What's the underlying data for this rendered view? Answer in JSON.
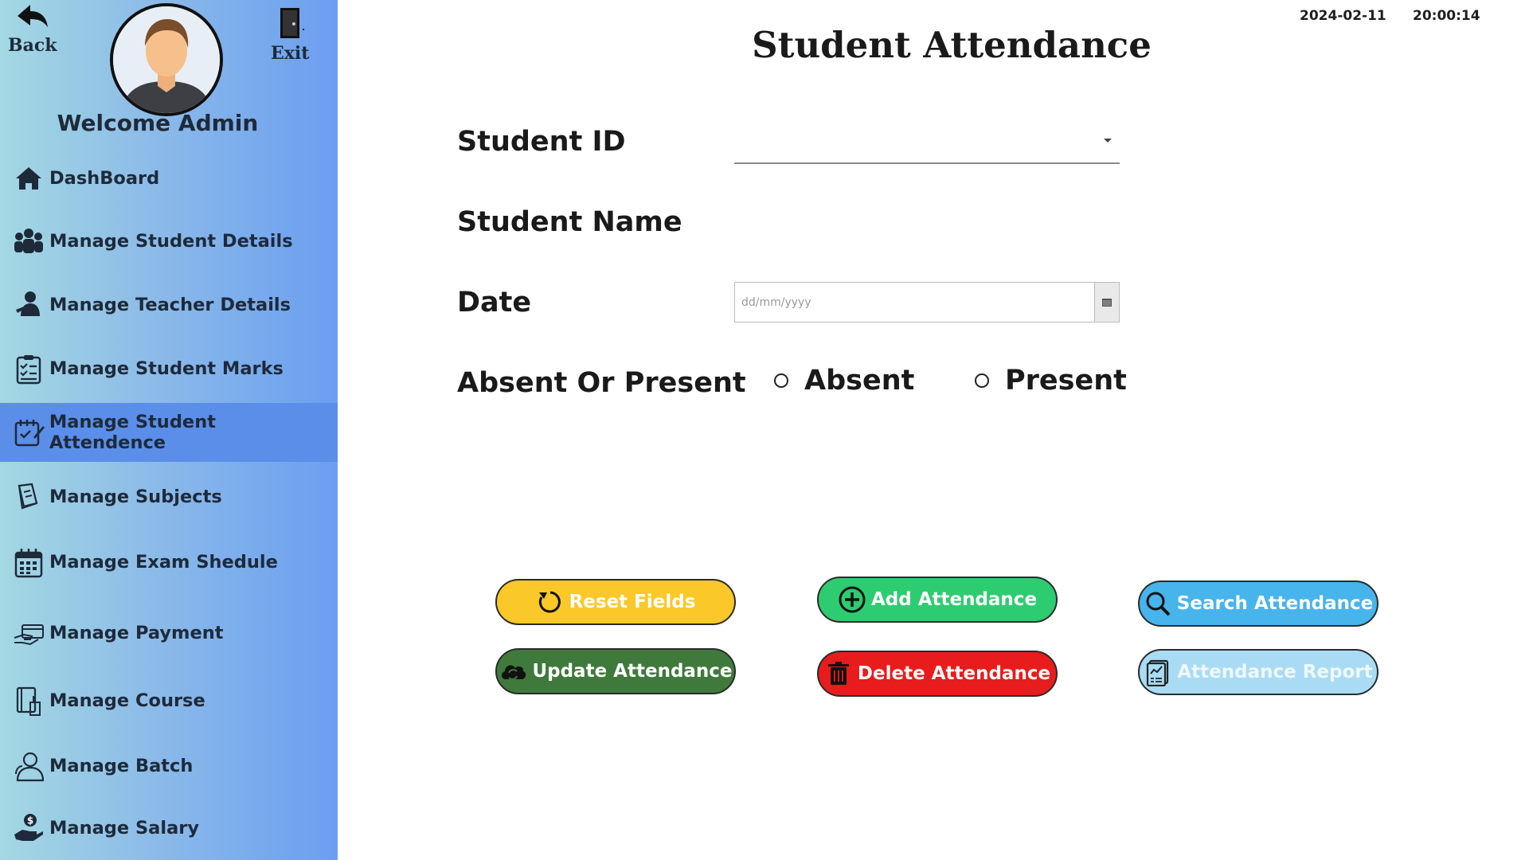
{
  "header": {
    "back_label": "Back",
    "exit_label": "Exit",
    "welcome": "Welcome Admin",
    "date": "2024-02-11",
    "time": "20:00:14"
  },
  "sidebar": {
    "active_index": 4,
    "items": [
      {
        "label": "DashBoard",
        "icon": "home-icon"
      },
      {
        "label": "Manage Student Details",
        "icon": "group-icon"
      },
      {
        "label": "Manage Teacher Details",
        "icon": "teacher-icon"
      },
      {
        "label": "Manage Student Marks",
        "icon": "checklist-icon"
      },
      {
        "label": "Manage Student Attendence",
        "icon": "attendance-calendar-icon"
      },
      {
        "label": "Manage Subjects",
        "icon": "book-icon"
      },
      {
        "label": "Manage Exam Shedule",
        "icon": "calendar-icon"
      },
      {
        "label": "Manage Payment",
        "icon": "payment-hand-icon"
      },
      {
        "label": "Manage Course",
        "icon": "course-icon"
      },
      {
        "label": "Manage Batch",
        "icon": "users-icon"
      },
      {
        "label": "Manage Salary",
        "icon": "salary-hand-icon"
      }
    ]
  },
  "main": {
    "title": "Student Attendance",
    "fields": {
      "student_id_label": "Student ID",
      "student_id_value": "",
      "student_name_label": "Student Name",
      "student_name_value": "",
      "date_label": "Date",
      "date_placeholder": "dd/mm/yyyy",
      "status_label": "Absent Or Present",
      "option_absent": "Absent",
      "option_present": "Present"
    },
    "buttons": {
      "reset": "Reset Fields",
      "add": "Add Attendance",
      "search": "Search Attendance",
      "update": "Update Attendance",
      "delete": "Delete Attendance",
      "report": "Attendance Report"
    }
  },
  "colors": {
    "sidebar_active": "#5a8ee8",
    "reset_button": "#fbc82a",
    "add_button": "#2ecc71",
    "search_button": "#47b4ec",
    "update_button": "#3f7a3c",
    "delete_button": "#e81c1c",
    "report_button": "#a9dcf4"
  }
}
